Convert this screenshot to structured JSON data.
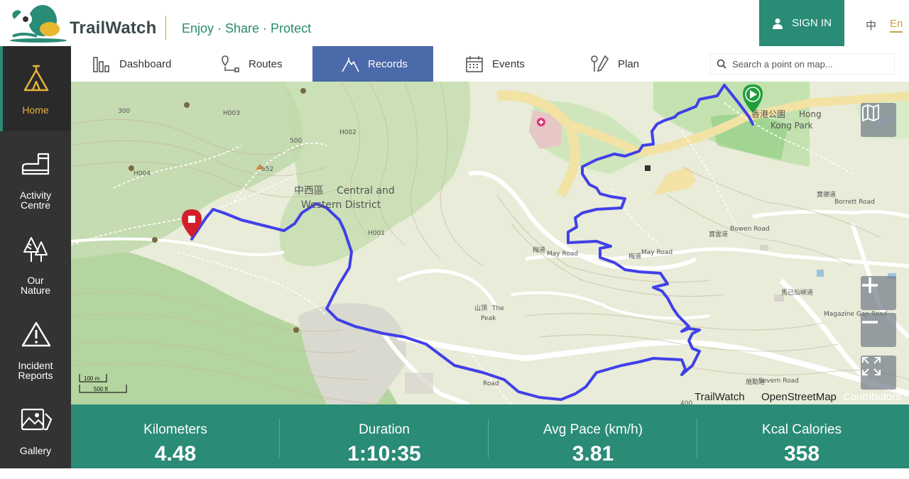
{
  "header": {
    "brand": "TrailWatch",
    "tagline": "Enjoy · Share · Protect",
    "sign_in": "SIGN IN",
    "lang_zh": "中",
    "lang_en": "En"
  },
  "sidebar": {
    "items": [
      {
        "label": "Home",
        "icon": "tent-icon"
      },
      {
        "label_line1": "Activity",
        "label_line2": "Centre",
        "icon": "boot-icon"
      },
      {
        "label_line1": "Our",
        "label_line2": "Nature",
        "icon": "trees-icon"
      },
      {
        "label_line1": "Incident",
        "label_line2": "Reports",
        "icon": "warning-icon"
      },
      {
        "label": "Gallery",
        "icon": "gallery-icon"
      }
    ]
  },
  "tabs": [
    {
      "label": "Dashboard",
      "icon": "bar-chart-icon"
    },
    {
      "label": "Routes",
      "icon": "route-icon"
    },
    {
      "label": "Records",
      "icon": "mountain-icon",
      "active": true
    },
    {
      "label": "Events",
      "icon": "calendar-icon"
    },
    {
      "label": "Plan",
      "icon": "map-pen-icon"
    }
  ],
  "search": {
    "placeholder": "Search a point on map..."
  },
  "map": {
    "labels": {
      "district_zh": "中西區",
      "district_en1": "Central and",
      "district_en2": "Western District",
      "peak_zh": "山頂",
      "peak_en1": "The",
      "peak_en2": "Peak",
      "park_zh": "香港公園",
      "park_en1": "Hong",
      "park_en2": "Kong Park",
      "bowen_zh": "寶雲道",
      "bowen_en": "Bowen Road",
      "may_zh": "梅道",
      "may_en": "May Road",
      "may2_zh": "梅道",
      "may2_en": "May Road",
      "magazine_zh": "馬己仙峽道",
      "magazine_en": "Magazine Gap Road",
      "severn_zh": "施勳道",
      "severn_en": "Severn Road",
      "borrett_zh": "寶德道",
      "borrett_en": "Borrett Road",
      "spot_height": "552",
      "h001": "H001",
      "h002": "H002",
      "h003": "H003",
      "h004": "H004",
      "c300": "300",
      "c400": "400",
      "c500": "500",
      "road": "Road"
    },
    "scale_m": "100 m",
    "scale_ft": "500 ft",
    "attribution": [
      "TrailWatch",
      "OpenStreetMap",
      "Contributors"
    ],
    "route_color": "#4040e8"
  },
  "stats": [
    {
      "label": "Kilometers",
      "value": "4.48"
    },
    {
      "label": "Duration",
      "value": "1:10:35"
    },
    {
      "label": "Avg Pace (km/h)",
      "value": "3.81"
    },
    {
      "label": "Kcal Calories",
      "value": "358"
    }
  ]
}
